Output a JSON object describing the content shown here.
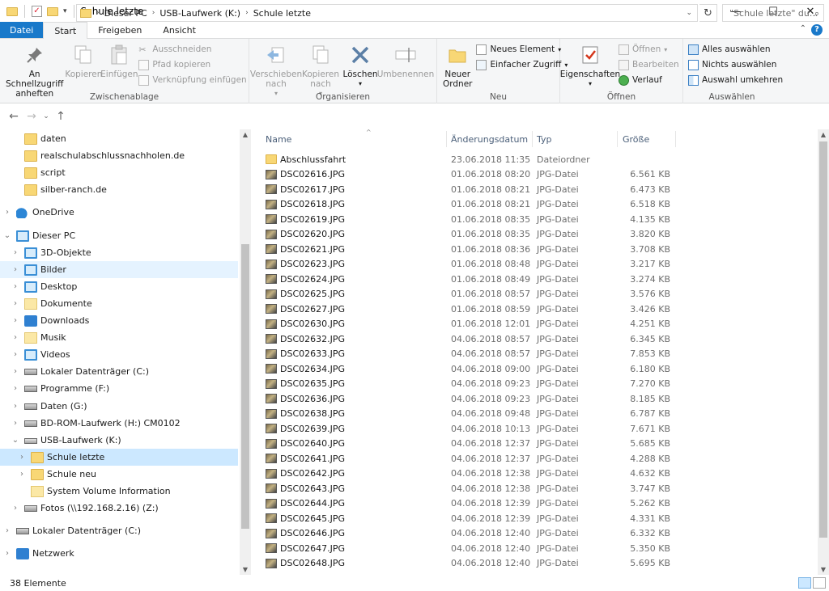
{
  "window": {
    "title": "Schule letzte",
    "min_glyph": "—",
    "max_glyph": "☐",
    "close_glyph": "✕"
  },
  "tabs": [
    {
      "label": "Datei"
    },
    {
      "label": "Start"
    },
    {
      "label": "Freigeben"
    },
    {
      "label": "Ansicht"
    }
  ],
  "ribbon": {
    "clipboard": {
      "label": "Zwischenablage",
      "pin": "An Schnellzugriff anheften",
      "copy": "Kopieren",
      "paste": "Einfügen",
      "cut": "Ausschneiden",
      "copy_path": "Pfad kopieren",
      "paste_shortcut": "Verknüpfung einfügen"
    },
    "organize": {
      "label": "Organisieren",
      "move_to": "Verschieben nach",
      "copy_to": "Kopieren nach",
      "delete": "Löschen",
      "rename": "Umbenennen"
    },
    "new": {
      "label": "Neu",
      "new_folder": "Neuer Ordner",
      "new_item": "Neues Element",
      "easy_access": "Einfacher Zugriff"
    },
    "open": {
      "label": "Öffnen",
      "properties": "Eigenschaften",
      "open": "Öffnen",
      "edit": "Bearbeiten",
      "history": "Verlauf"
    },
    "select": {
      "label": "Auswählen",
      "select_all": "Alles auswählen",
      "select_none": "Nichts auswählen",
      "invert": "Auswahl umkehren"
    }
  },
  "address": {
    "crumbs": [
      "Dieser PC",
      "USB-Laufwerk (K:)",
      "Schule letzte"
    ],
    "search_placeholder": "\"Schule letzte\" du..."
  },
  "nav_tree": [
    {
      "label": "daten",
      "icon": "folder-icon",
      "indent": 2,
      "expander": false
    },
    {
      "label": "realschulabschlussnachholen.de",
      "icon": "folder-icon",
      "indent": 2,
      "expander": false
    },
    {
      "label": "script",
      "icon": "folder-icon",
      "indent": 2,
      "expander": false
    },
    {
      "label": "silber-ranch.de",
      "icon": "folder-icon",
      "indent": 2,
      "expander": false
    },
    {
      "label": "OneDrive",
      "icon": "onedrive-icon",
      "indent": 1,
      "expander": "›",
      "gap": true
    },
    {
      "label": "Dieser PC",
      "icon": "pc-icon",
      "indent": 1,
      "expander": "⌄",
      "gap": true
    },
    {
      "label": "3D-Objekte",
      "icon": "cube-icon",
      "indent": 2,
      "expander": "›"
    },
    {
      "label": "Bilder",
      "icon": "pictures-icon",
      "indent": 2,
      "expander": "›",
      "state": "hov"
    },
    {
      "label": "Desktop",
      "icon": "desktop-icon",
      "indent": 2,
      "expander": "›"
    },
    {
      "label": "Dokumente",
      "icon": "documents-icon",
      "indent": 2,
      "expander": "›"
    },
    {
      "label": "Downloads",
      "icon": "downloads-icon",
      "indent": 2,
      "expander": "›"
    },
    {
      "label": "Musik",
      "icon": "music-icon",
      "indent": 2,
      "expander": "›"
    },
    {
      "label": "Videos",
      "icon": "videos-icon",
      "indent": 2,
      "expander": "›"
    },
    {
      "label": "Lokaler Datenträger (C:)",
      "icon": "drive-icon",
      "indent": 2,
      "expander": "›"
    },
    {
      "label": "Programme (F:)",
      "icon": "drive-icon",
      "indent": 2,
      "expander": "›"
    },
    {
      "label": "Daten (G:)",
      "icon": "drive-icon",
      "indent": 2,
      "expander": "›"
    },
    {
      "label": "BD-ROM-Laufwerk (H:) CM0102",
      "icon": "disc-icon",
      "indent": 2,
      "expander": "›"
    },
    {
      "label": "USB-Laufwerk (K:)",
      "icon": "usb-drive-icon",
      "indent": 2,
      "expander": "⌄"
    },
    {
      "label": "Schule letzte",
      "icon": "folder-icon",
      "indent": 3,
      "expander": "›",
      "state": "sel"
    },
    {
      "label": "Schule neu",
      "icon": "folder-icon",
      "indent": 3,
      "expander": "›"
    },
    {
      "label": "System Volume Information",
      "icon": "folder-icon",
      "indent": 3,
      "expander": false
    },
    {
      "label": "Fotos (\\\\192.168.2.16) (Z:)",
      "icon": "network-drive-icon",
      "indent": 2,
      "expander": "›"
    },
    {
      "label": "Lokaler Datenträger (C:)",
      "icon": "drive-icon",
      "indent": 1,
      "expander": "›",
      "gap": true
    },
    {
      "label": "Netzwerk",
      "icon": "network-icon",
      "indent": 1,
      "expander": "›",
      "gap": true
    }
  ],
  "columns": {
    "name": "Name",
    "date": "Änderungsdatum",
    "type": "Typ",
    "size": "Größe"
  },
  "files": [
    {
      "name": "Abschlussfahrt",
      "date": "23.06.2018 11:35",
      "type": "Dateiordner",
      "size": "",
      "icon": "folder-icon"
    },
    {
      "name": "DSC02616.JPG",
      "date": "01.06.2018 08:20",
      "type": "JPG-Datei",
      "size": "6.561 KB",
      "icon": "jpg-file-icon"
    },
    {
      "name": "DSC02617.JPG",
      "date": "01.06.2018 08:21",
      "type": "JPG-Datei",
      "size": "6.473 KB",
      "icon": "jpg-file-icon"
    },
    {
      "name": "DSC02618.JPG",
      "date": "01.06.2018 08:21",
      "type": "JPG-Datei",
      "size": "6.518 KB",
      "icon": "jpg-file-icon"
    },
    {
      "name": "DSC02619.JPG",
      "date": "01.06.2018 08:35",
      "type": "JPG-Datei",
      "size": "4.135 KB",
      "icon": "jpg-file-icon"
    },
    {
      "name": "DSC02620.JPG",
      "date": "01.06.2018 08:35",
      "type": "JPG-Datei",
      "size": "3.820 KB",
      "icon": "jpg-file-icon"
    },
    {
      "name": "DSC02621.JPG",
      "date": "01.06.2018 08:36",
      "type": "JPG-Datei",
      "size": "3.708 KB",
      "icon": "jpg-file-icon"
    },
    {
      "name": "DSC02623.JPG",
      "date": "01.06.2018 08:48",
      "type": "JPG-Datei",
      "size": "3.217 KB",
      "icon": "jpg-file-icon"
    },
    {
      "name": "DSC02624.JPG",
      "date": "01.06.2018 08:49",
      "type": "JPG-Datei",
      "size": "3.274 KB",
      "icon": "jpg-file-icon"
    },
    {
      "name": "DSC02625.JPG",
      "date": "01.06.2018 08:57",
      "type": "JPG-Datei",
      "size": "3.576 KB",
      "icon": "jpg-file-icon"
    },
    {
      "name": "DSC02627.JPG",
      "date": "01.06.2018 08:59",
      "type": "JPG-Datei",
      "size": "3.426 KB",
      "icon": "jpg-file-icon"
    },
    {
      "name": "DSC02630.JPG",
      "date": "01.06.2018 12:01",
      "type": "JPG-Datei",
      "size": "4.251 KB",
      "icon": "jpg-file-icon"
    },
    {
      "name": "DSC02632.JPG",
      "date": "04.06.2018 08:57",
      "type": "JPG-Datei",
      "size": "6.345 KB",
      "icon": "jpg-file-icon"
    },
    {
      "name": "DSC02633.JPG",
      "date": "04.06.2018 08:57",
      "type": "JPG-Datei",
      "size": "7.853 KB",
      "icon": "jpg-file-icon"
    },
    {
      "name": "DSC02634.JPG",
      "date": "04.06.2018 09:00",
      "type": "JPG-Datei",
      "size": "6.180 KB",
      "icon": "jpg-file-icon"
    },
    {
      "name": "DSC02635.JPG",
      "date": "04.06.2018 09:23",
      "type": "JPG-Datei",
      "size": "7.270 KB",
      "icon": "jpg-file-icon"
    },
    {
      "name": "DSC02636.JPG",
      "date": "04.06.2018 09:23",
      "type": "JPG-Datei",
      "size": "8.185 KB",
      "icon": "jpg-file-icon"
    },
    {
      "name": "DSC02638.JPG",
      "date": "04.06.2018 09:48",
      "type": "JPG-Datei",
      "size": "6.787 KB",
      "icon": "jpg-file-icon"
    },
    {
      "name": "DSC02639.JPG",
      "date": "04.06.2018 10:13",
      "type": "JPG-Datei",
      "size": "7.671 KB",
      "icon": "jpg-file-icon"
    },
    {
      "name": "DSC02640.JPG",
      "date": "04.06.2018 12:37",
      "type": "JPG-Datei",
      "size": "5.685 KB",
      "icon": "jpg-file-icon"
    },
    {
      "name": "DSC02641.JPG",
      "date": "04.06.2018 12:37",
      "type": "JPG-Datei",
      "size": "4.288 KB",
      "icon": "jpg-file-icon"
    },
    {
      "name": "DSC02642.JPG",
      "date": "04.06.2018 12:38",
      "type": "JPG-Datei",
      "size": "4.632 KB",
      "icon": "jpg-file-icon"
    },
    {
      "name": "DSC02643.JPG",
      "date": "04.06.2018 12:38",
      "type": "JPG-Datei",
      "size": "3.747 KB",
      "icon": "jpg-file-icon"
    },
    {
      "name": "DSC02644.JPG",
      "date": "04.06.2018 12:39",
      "type": "JPG-Datei",
      "size": "5.262 KB",
      "icon": "jpg-file-icon"
    },
    {
      "name": "DSC02645.JPG",
      "date": "04.06.2018 12:39",
      "type": "JPG-Datei",
      "size": "4.331 KB",
      "icon": "jpg-file-icon"
    },
    {
      "name": "DSC02646.JPG",
      "date": "04.06.2018 12:40",
      "type": "JPG-Datei",
      "size": "6.332 KB",
      "icon": "jpg-file-icon"
    },
    {
      "name": "DSC02647.JPG",
      "date": "04.06.2018 12:40",
      "type": "JPG-Datei",
      "size": "5.350 KB",
      "icon": "jpg-file-icon"
    },
    {
      "name": "DSC02648.JPG",
      "date": "04.06.2018 12:40",
      "type": "JPG-Datei",
      "size": "5.695 KB",
      "icon": "jpg-file-icon"
    }
  ],
  "status": {
    "count": "38 Elemente"
  },
  "colors": {
    "accent": "#1979ca",
    "selection": "#cce8ff",
    "hover": "#e5f3ff",
    "folder": "#f8d775"
  }
}
